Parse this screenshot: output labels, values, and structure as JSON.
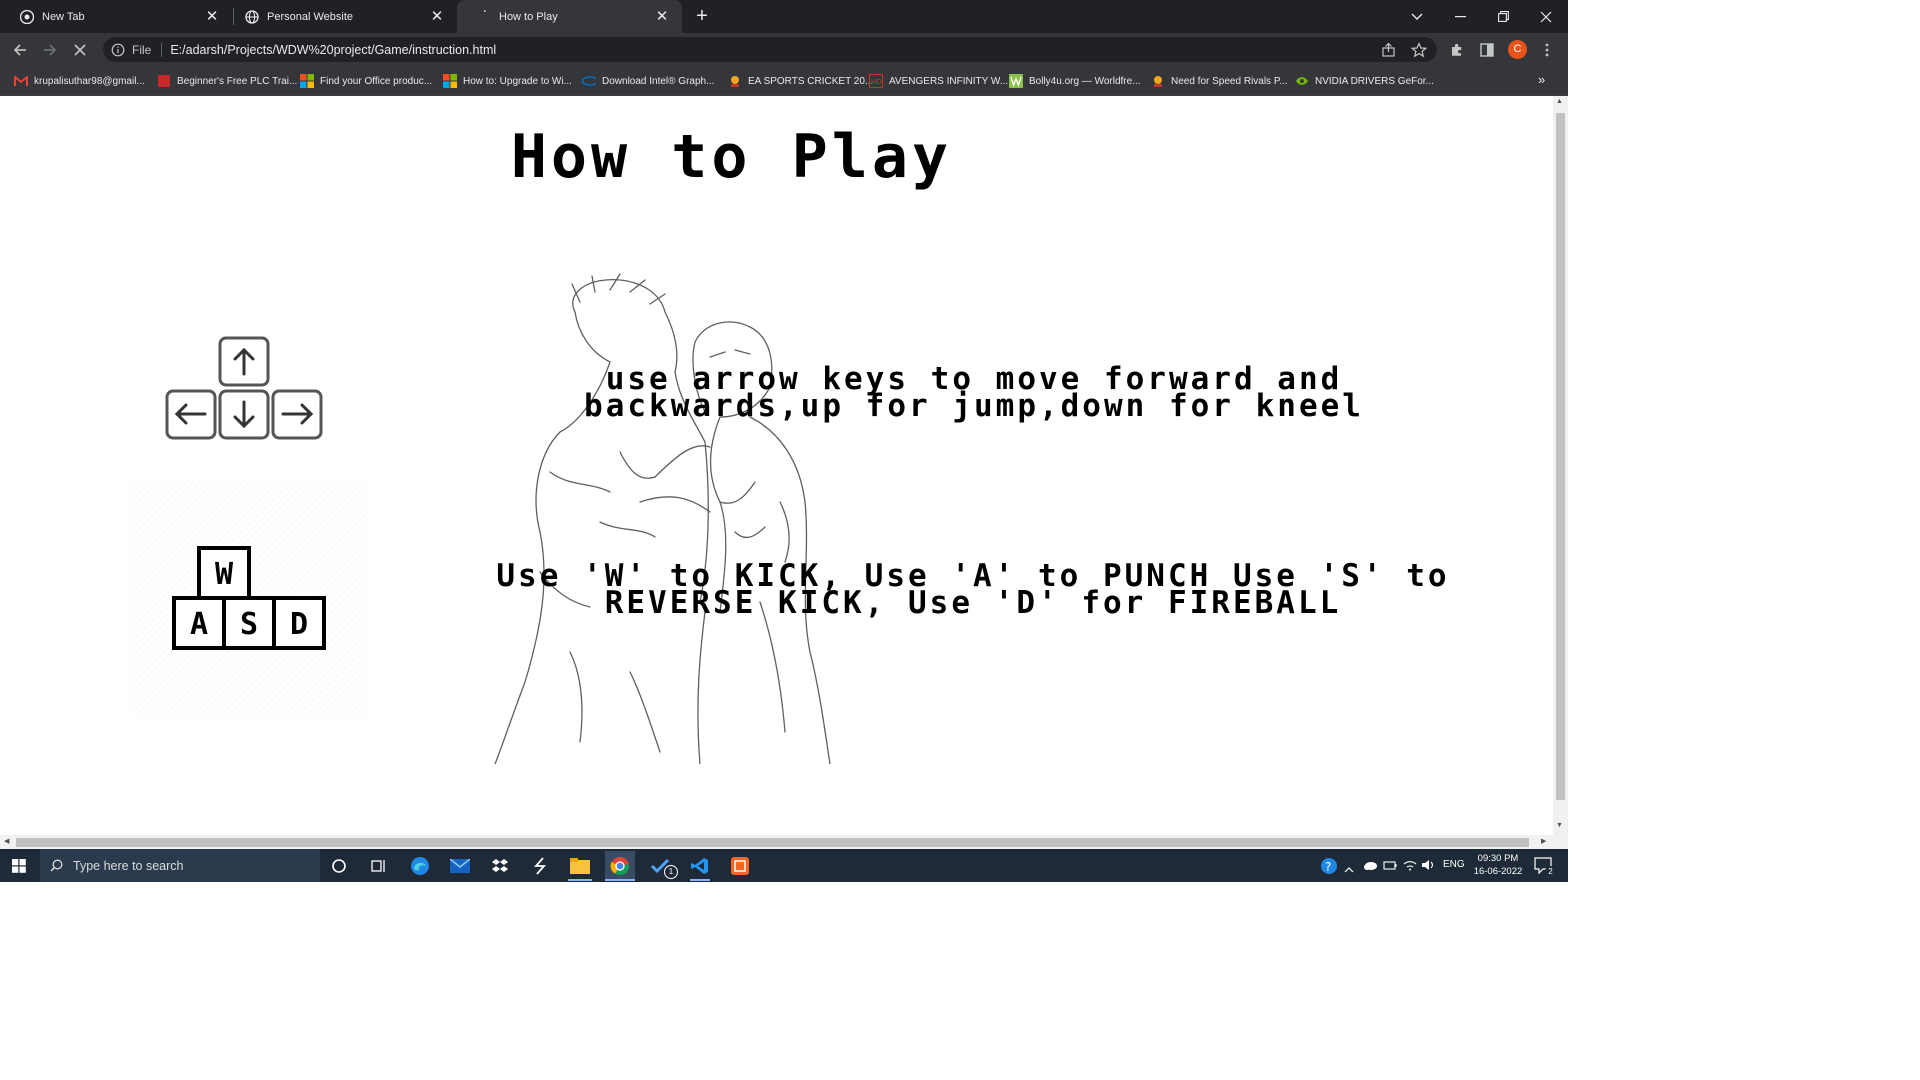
{
  "browser": {
    "tabs": [
      {
        "title": "New Tab",
        "icon": "chrome-icon"
      },
      {
        "title": "Personal Website",
        "icon": "globe-icon"
      },
      {
        "title": "How to Play",
        "icon": "loading-icon"
      }
    ],
    "address": {
      "scheme_label": "File",
      "url": "E:/adarsh/Projects/WDW%20project/Game/instruction.html"
    },
    "profile_initial": "C",
    "bookmarks": [
      {
        "label": "krupalisuthar98@gmail...",
        "icon": "gmail-icon",
        "color": "#ea4335"
      },
      {
        "label": "Beginner's Free PLC Trai...",
        "icon": "book-icon",
        "color": "#c62828"
      },
      {
        "label": "Find your Office produc...",
        "icon": "microsoft-icon",
        "color": "#f25022"
      },
      {
        "label": "How to: Upgrade to Wi...",
        "icon": "microsoft-icon",
        "color": "#f25022"
      },
      {
        "label": "Download Intel® Graph...",
        "icon": "intel-icon",
        "color": "#0071c5"
      },
      {
        "label": "EA SPORTS CRICKET 20...",
        "icon": "game-icon",
        "color": "#f4a621"
      },
      {
        "label": "AVENGERS INFINITY W...",
        "icon": "hd-icon",
        "color": "#c0392b"
      },
      {
        "label": "Bolly4u.org — Worldfre...",
        "icon": "w-icon",
        "color": "#8bc34a"
      },
      {
        "label": "Need for Speed Rivals P...",
        "icon": "game-icon",
        "color": "#f4a621"
      },
      {
        "label": "NVIDIA DRIVERS GeFor...",
        "icon": "nvidia-icon",
        "color": "#76b900"
      }
    ]
  },
  "page": {
    "heading": "How to Play",
    "arrow_instruction": "use arrow keys to move forward and backwards,up for jump,down for kneel",
    "wasd_instruction": "Use 'W' to KICK, Use 'A' to PUNCH Use 'S' to REVERSE KICK, Use 'D' for FIREBALL",
    "keys": {
      "up": "↑",
      "left": "←",
      "down": "↓",
      "right": "→",
      "w": "W",
      "a": "A",
      "s": "S",
      "d": "D"
    }
  },
  "taskbar": {
    "search_placeholder": "Type here to search",
    "language": "ENG",
    "time": "09:30 PM",
    "date": "16-06-2022",
    "notifications": "2",
    "todo_badge": "1"
  },
  "colors": {
    "tabbar_bg": "#202124",
    "toolbar_bg": "#35363a",
    "taskbar_bg": "#1f2a38",
    "avatar": "#e8541a"
  }
}
